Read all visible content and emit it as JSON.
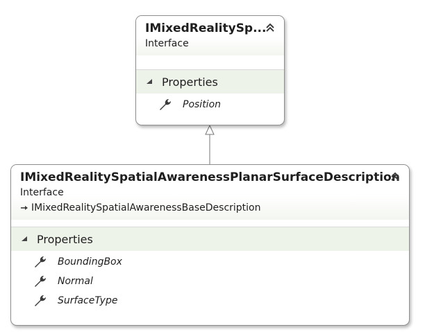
{
  "parent": {
    "title": "IMixedRealitySp...",
    "stereotype": "Interface",
    "section_label": "Properties",
    "members": [
      "Position"
    ]
  },
  "child": {
    "title": "IMixedRealitySpatialAwarenessPlanarSurfaceDescription",
    "stereotype": "Interface",
    "base_type": "IMixedRealitySpatialAwarenessBaseDescription",
    "section_label": "Properties",
    "members": [
      "BoundingBox",
      "Normal",
      "SurfaceType"
    ]
  },
  "icons": {
    "collapse": "double-chevron-up-icon",
    "section_toggle": "triangle-expanded-icon",
    "property": "wrench-icon",
    "inheritance": "inheritance-arrow-icon"
  },
  "colors": {
    "section_background": "#eef3ea",
    "border": "#8e8e8e"
  }
}
